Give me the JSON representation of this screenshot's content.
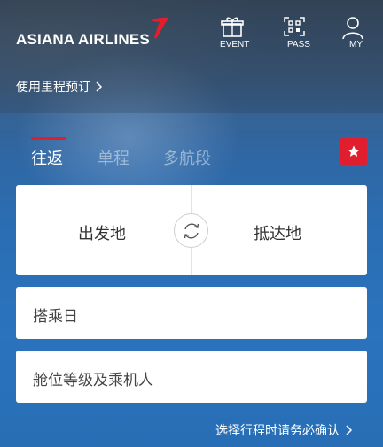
{
  "header": {
    "logo_text": "ASIANA AIRLINES",
    "buttons": [
      {
        "label": "EVENT",
        "icon": "gift-icon"
      },
      {
        "label": "PASS",
        "icon": "qr-code-icon"
      },
      {
        "label": "MY",
        "icon": "user-icon"
      }
    ]
  },
  "mileage_link": {
    "label": "使用里程预订",
    "icon": "chevron-right-icon"
  },
  "tabs": [
    {
      "label": "往返",
      "active": true
    },
    {
      "label": "单程",
      "active": false
    },
    {
      "label": "多航段",
      "active": false
    }
  ],
  "favorite": {
    "icon": "star-icon",
    "color": "#e01e2e"
  },
  "route": {
    "origin_placeholder": "出发地",
    "destination_placeholder": "抵达地",
    "swap_icon": "swap-refresh-icon"
  },
  "fields": {
    "date_placeholder": "搭乘日",
    "cabin_placeholder": "舱位等级及乘机人"
  },
  "notice": {
    "label": "选择行程时请务必确认",
    "icon": "chevron-right-icon"
  },
  "colors": {
    "accent": "#e01e2e",
    "text_dark": "#333333",
    "background": "#2a6fb6"
  }
}
